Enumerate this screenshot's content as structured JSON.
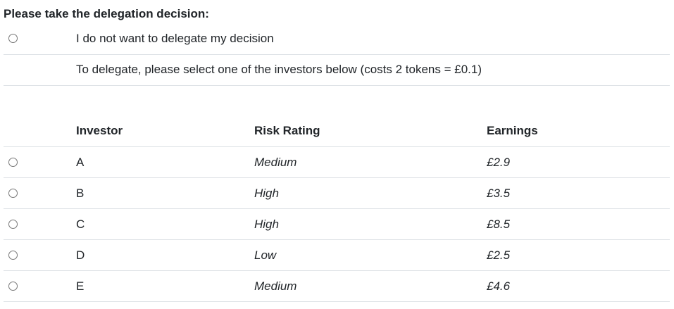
{
  "heading": "Please take the delegation decision:",
  "no_delegate_label": "I do not want to delegate my decision",
  "delegate_instruction": "To delegate, please select one of the investors below (costs 2 tokens = £0.1)",
  "columns": {
    "investor": "Investor",
    "risk": "Risk Rating",
    "earnings": "Earnings"
  },
  "investors": [
    {
      "name": "A",
      "risk": "Medium",
      "earnings": "£2.9"
    },
    {
      "name": "B",
      "risk": "High",
      "earnings": "£3.5"
    },
    {
      "name": "C",
      "risk": "High",
      "earnings": "£8.5"
    },
    {
      "name": "D",
      "risk": "Low",
      "earnings": "£2.5"
    },
    {
      "name": "E",
      "risk": "Medium",
      "earnings": "£4.6"
    }
  ]
}
